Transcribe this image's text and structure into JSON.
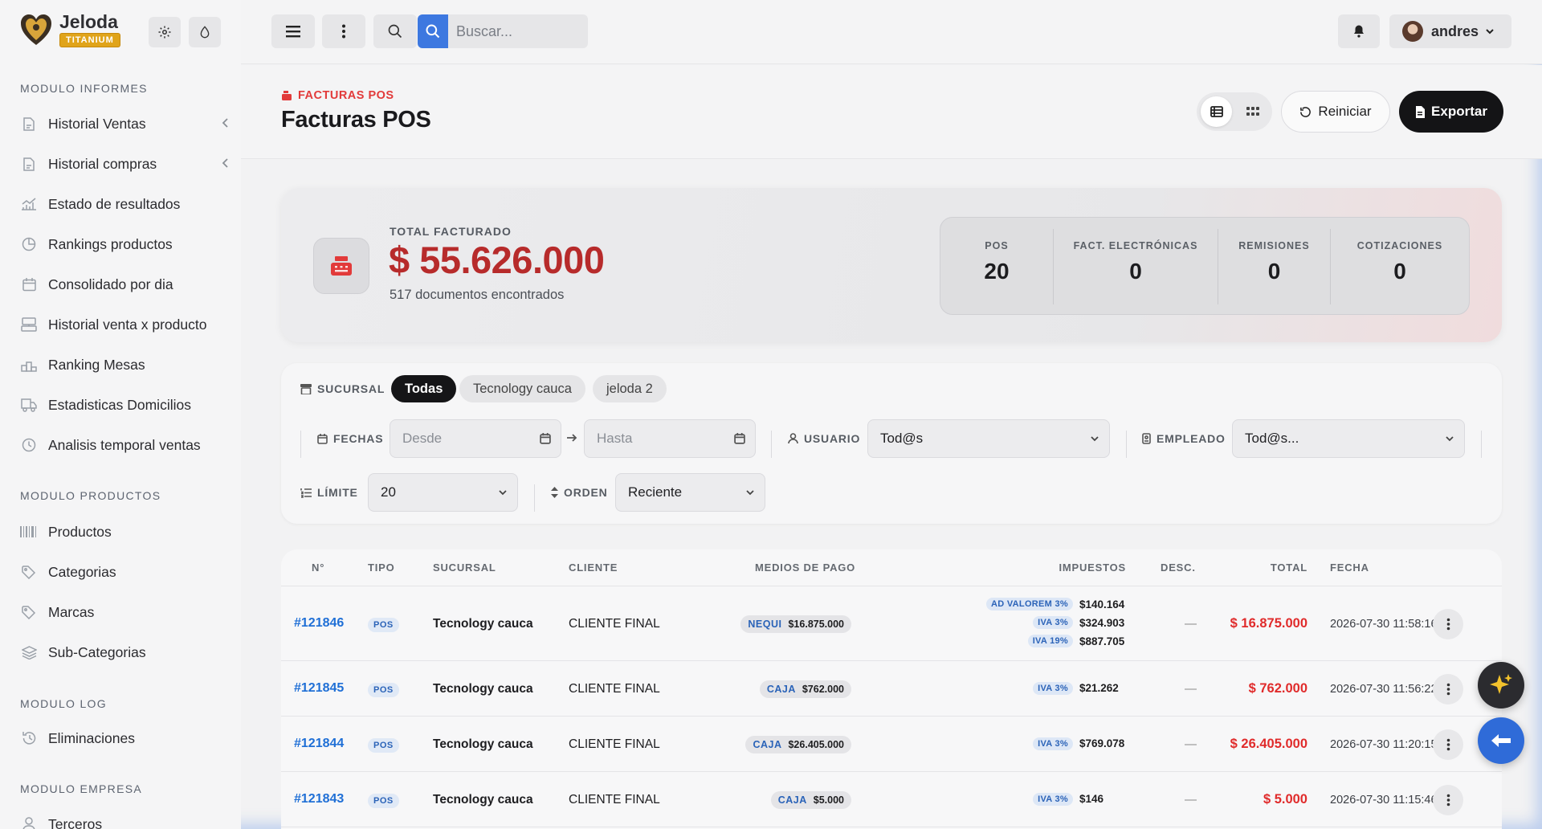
{
  "brand": {
    "name": "Jeloda",
    "badge": "TITANIUM"
  },
  "sidebar": {
    "sections": [
      {
        "title": "MODULO INFORMES",
        "items": [
          {
            "label": "Historial Ventas",
            "icon": "file-icon",
            "chevron": true
          },
          {
            "label": "Historial compras",
            "icon": "file-icon",
            "chevron": true
          },
          {
            "label": "Estado de resultados",
            "icon": "chart-icon",
            "chevron": false
          },
          {
            "label": "Rankings productos",
            "icon": "pie-icon",
            "chevron": false
          },
          {
            "label": "Consolidado por dia",
            "icon": "calendar-icon",
            "chevron": false
          },
          {
            "label": "Historial venta x producto",
            "icon": "register-icon",
            "chevron": false
          },
          {
            "label": "Ranking Mesas",
            "icon": "podium-icon",
            "chevron": false
          },
          {
            "label": "Estadisticas Domicilios",
            "icon": "truck-icon",
            "chevron": false
          },
          {
            "label": "Analisis temporal ventas",
            "icon": "clock-icon",
            "chevron": false
          }
        ]
      },
      {
        "title": "MODULO PRODUCTOS",
        "items": [
          {
            "label": "Productos",
            "icon": "barcode-icon",
            "chevron": false
          },
          {
            "label": "Categorias",
            "icon": "tag-icon",
            "chevron": false
          },
          {
            "label": "Marcas",
            "icon": "tag-icon",
            "chevron": false
          },
          {
            "label": "Sub-Categorias",
            "icon": "layers-icon",
            "chevron": false
          }
        ]
      },
      {
        "title": "MODULO LOG",
        "items": [
          {
            "label": "Eliminaciones",
            "icon": "history-icon",
            "chevron": false
          }
        ]
      },
      {
        "title": "MODULO EMPRESA",
        "items": [
          {
            "label": "Terceros",
            "icon": "user-icon",
            "chevron": false
          }
        ]
      }
    ]
  },
  "topbar": {
    "search_placeholder": "Buscar...",
    "user_name": "andres"
  },
  "header": {
    "breadcrumb": "FACTURAS POS",
    "title": "Facturas POS",
    "reset_label": "Reiniciar",
    "export_label": "Exportar"
  },
  "summary": {
    "label": "TOTAL FACTURADO",
    "value": "$ 55.626.000",
    "subtitle": "517 documentos encontrados",
    "stats": [
      {
        "label": "POS",
        "value": "20"
      },
      {
        "label": "FACT. ELECTRÓNICAS",
        "value": "0"
      },
      {
        "label": "REMISIONES",
        "value": "0"
      },
      {
        "label": "COTIZACIONES",
        "value": "0"
      }
    ]
  },
  "filters": {
    "sucursal_label": "SUCURSAL",
    "sucursales": [
      "Todas",
      "Tecnology cauca",
      "jeloda 2"
    ],
    "fechas_label": "FECHAS",
    "desde_placeholder": "Desde",
    "hasta_placeholder": "Hasta",
    "usuario_label": "USUARIO",
    "usuario_value": "Tod@s",
    "empleado_label": "EMPLEADO",
    "empleado_value": "Tod@s...",
    "limite_label": "LÍMITE",
    "limite_value": "20",
    "orden_label": "ORDEN",
    "orden_value": "Reciente"
  },
  "table": {
    "headers": [
      "N°",
      "TIPO",
      "SUCURSAL",
      "CLIENTE",
      "MEDIOS DE PAGO",
      "IMPUESTOS",
      "DESC.",
      "TOTAL",
      "FECHA"
    ],
    "rows": [
      {
        "num": "#121846",
        "tipo": "POS",
        "sucursal": "Tecnology cauca",
        "cliente": "CLIENTE FINAL",
        "pago": {
          "metodo": "NEQUI",
          "monto": "$16.875.000"
        },
        "impuestos": [
          {
            "tipo": "AD VALOREM 3%",
            "valor": "$140.164"
          },
          {
            "tipo": "IVA 3%",
            "valor": "$324.903"
          },
          {
            "tipo": "IVA 19%",
            "valor": "$887.705"
          }
        ],
        "desc": "—",
        "total": "$ 16.875.000",
        "fecha": "2026-07-30 11:58:16"
      },
      {
        "num": "#121845",
        "tipo": "POS",
        "sucursal": "Tecnology cauca",
        "cliente": "CLIENTE FINAL",
        "pago": {
          "metodo": "CAJA",
          "monto": "$762.000"
        },
        "impuestos": [
          {
            "tipo": "IVA 3%",
            "valor": "$21.262"
          }
        ],
        "desc": "—",
        "total": "$ 762.000",
        "fecha": "2026-07-30 11:56:22"
      },
      {
        "num": "#121844",
        "tipo": "POS",
        "sucursal": "Tecnology cauca",
        "cliente": "CLIENTE FINAL",
        "pago": {
          "metodo": "CAJA",
          "monto": "$26.405.000"
        },
        "impuestos": [
          {
            "tipo": "IVA 3%",
            "valor": "$769.078"
          }
        ],
        "desc": "—",
        "total": "$ 26.405.000",
        "fecha": "2026-07-30 11:20:15"
      },
      {
        "num": "#121843",
        "tipo": "POS",
        "sucursal": "Tecnology cauca",
        "cliente": "CLIENTE FINAL",
        "pago": {
          "metodo": "CAJA",
          "monto": "$5.000"
        },
        "impuestos": [
          {
            "tipo": "IVA 3%",
            "valor": "$146"
          }
        ],
        "desc": "—",
        "total": "$ 5.000",
        "fecha": "2026-07-30 11:15:46"
      }
    ]
  },
  "colors": {
    "accent_red": "#b72b2b",
    "link_blue": "#1f6fd6",
    "brand_gold": "#e0a41a",
    "search_blue": "#3d78e0",
    "fab_blue": "#2f6bd8"
  }
}
